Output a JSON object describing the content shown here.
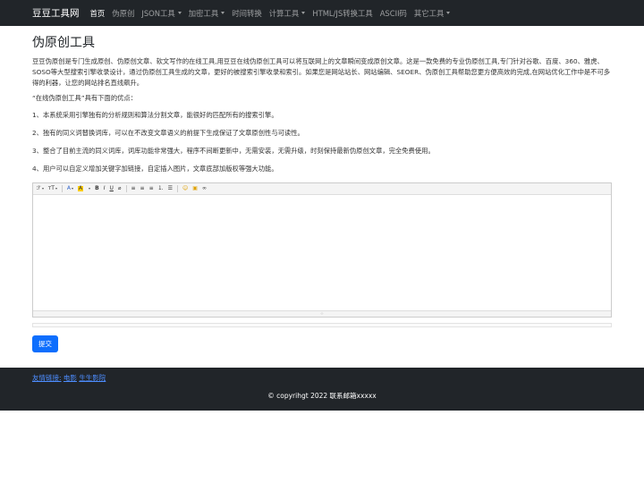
{
  "navbar": {
    "brand": "豆豆工具网",
    "items": [
      {
        "label": "首页",
        "active": true,
        "dropdown": false
      },
      {
        "label": "伪原创",
        "active": false,
        "dropdown": false
      },
      {
        "label": "JSON工具",
        "active": false,
        "dropdown": true
      },
      {
        "label": "加密工具",
        "active": false,
        "dropdown": true
      },
      {
        "label": "时间转换",
        "active": false,
        "dropdown": false
      },
      {
        "label": "计算工具",
        "active": false,
        "dropdown": true
      },
      {
        "label": "HTML/JS转换工具",
        "active": false,
        "dropdown": false
      },
      {
        "label": "ASCII码",
        "active": false,
        "dropdown": false
      },
      {
        "label": "其它工具",
        "active": false,
        "dropdown": true
      }
    ]
  },
  "main": {
    "title": "伪原创工具",
    "intro": "豆豆伪原创是专门生成原创、伪原创文章、软文写作的在线工具,用豆豆在线伪原创工具可以将互联网上的文章瞬间变成原创文章。这是一款免费的专业伪原创工具,专门针对谷歌、百度、360、雅虎、SOSO等大型搜索引擎收录设计，通过伪原创工具生成的文章，更好的被搜索引擎收录和索引。如果您是网站站长、网站编辑、SEOER、伪原创工具帮助您更方便高效的完成,在网站优化工作中是不可多得的利器，让您的网站排名直线飙升。",
    "advantages_heading": "“在线伪原创工具”具有下面的优点：",
    "features": [
      "1、本系统采用引擎独有的分析规则和算法分割文章，能很好的匹配所有的搜索引擎。",
      "2、独有的同义词替换词库，可以在不改变文章语义的前提下生成保证了文章原创性与可读性。",
      "3、整合了目前主流的同义词库，词库功能非常强大，程序不间断更新中，无需安装，无需升级，时刻保持最新伪原创文章，完全免费使用。",
      "4、用户可以自定义增加关键字加链接，自定插入图片，文章底部加版权等强大功能。"
    ],
    "editor": {
      "toolbar": {
        "font_family": "ℱ",
        "font_size": "ᴛT",
        "font_color": "A",
        "highlight": "A",
        "bold": "B",
        "italic": "I",
        "underline": "U",
        "clear": "⌀",
        "align_left": "≡",
        "align_center": "≡",
        "align_right": "≡",
        "ordered_list": "⒈",
        "unordered_list": "☰",
        "emoji": "☺",
        "image": "▣",
        "link": "∞"
      },
      "resize_grip": "⁘"
    },
    "submit_label": "提交"
  },
  "footer": {
    "links_label": "友情链接:",
    "links": [
      "电影",
      "生生影院"
    ],
    "copyright": "© copyrihgt 2022 联系邮箱xxxxx"
  },
  "colors": {
    "navbar_bg": "#212529",
    "primary": "#0d6efd",
    "link": "#4d8dff"
  }
}
